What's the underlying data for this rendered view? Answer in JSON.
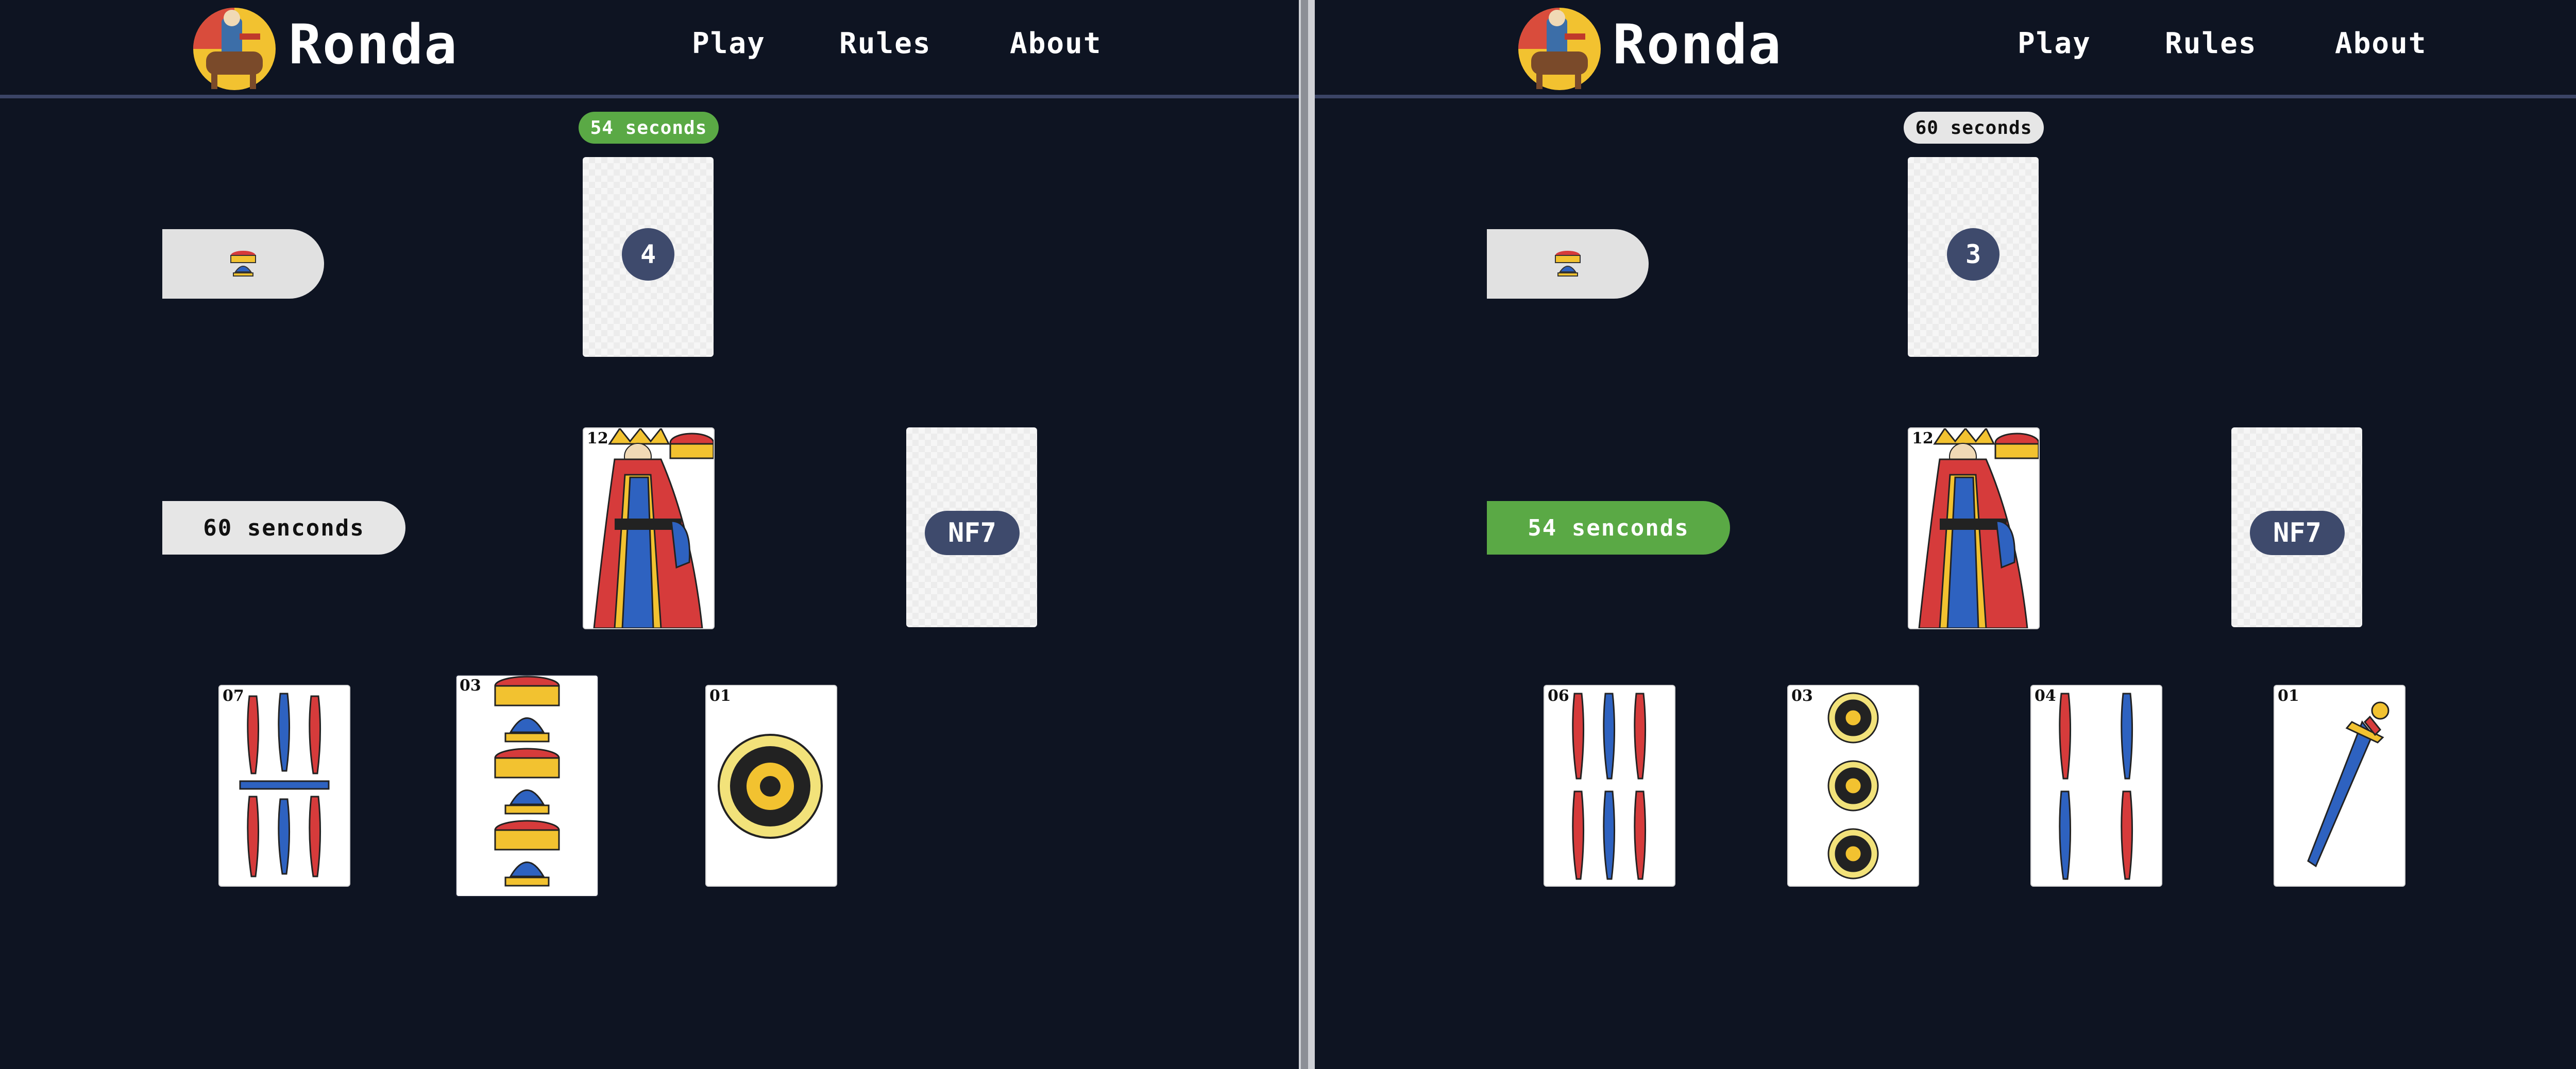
{
  "brand": "Ronda",
  "nav": [
    "Play",
    "Rules",
    "About"
  ],
  "left_view": {
    "opponent_timer": "54 seconds",
    "opponent_hand_count": "4",
    "player_timer": "60 senconds",
    "table_card_number": "12",
    "deck_label": "NF7",
    "hand": [
      {
        "number": "07",
        "suit": "batons"
      },
      {
        "number": "03",
        "suit": "cups"
      },
      {
        "number": "01",
        "suit": "coins"
      }
    ]
  },
  "right_view": {
    "opponent_timer": "60 seconds",
    "opponent_hand_count": "3",
    "player_timer": "54 senconds",
    "table_card_number": "12",
    "deck_label": "NF7",
    "hand": [
      {
        "number": "06",
        "suit": "batons"
      },
      {
        "number": "03",
        "suit": "coins"
      },
      {
        "number": "04",
        "suit": "batons"
      },
      {
        "number": "01",
        "suit": "swords"
      }
    ]
  },
  "colors": {
    "background": "#0e1422",
    "active_timer": "#5aa945",
    "idle_timer": "#e6e6e6",
    "badge": "#3e4a6c",
    "header_line": "#3b4466"
  },
  "icons": [
    "logo-horseman-icon",
    "opponent-avatar-cup-icon"
  ]
}
